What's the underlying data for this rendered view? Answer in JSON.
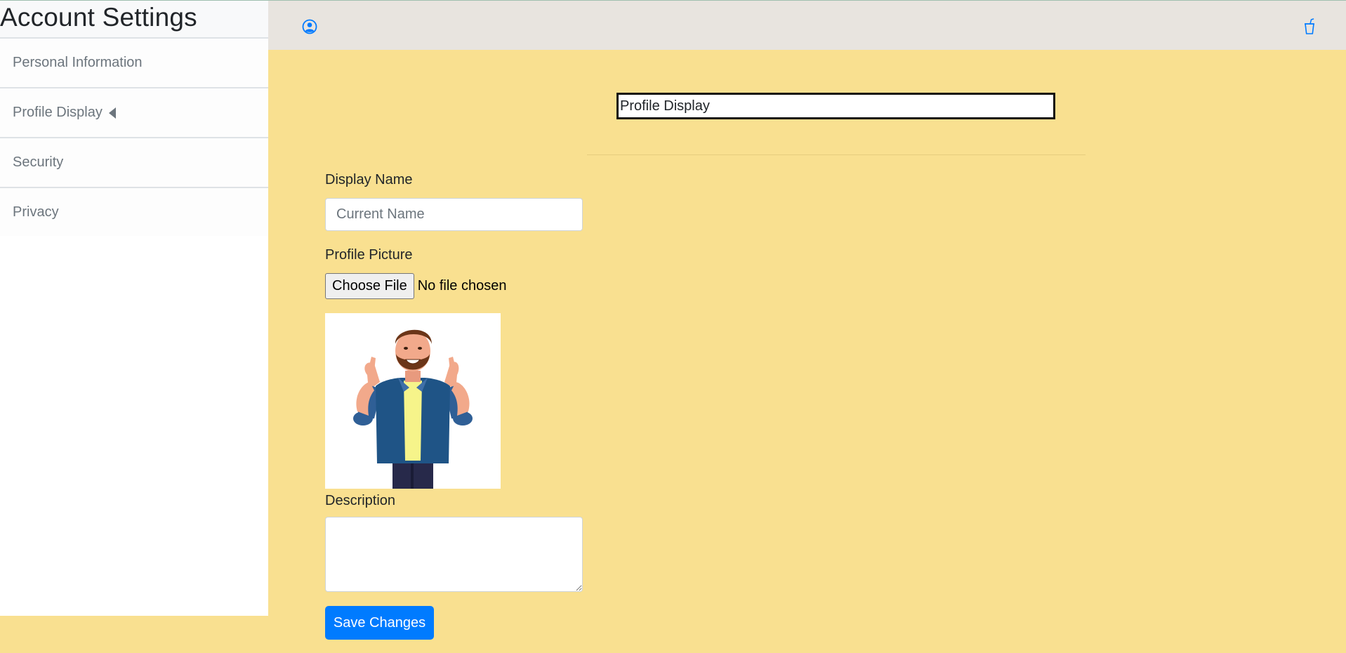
{
  "sidebar": {
    "title": "Account Settings",
    "items": [
      {
        "label": "Personal Information"
      },
      {
        "label": "Profile Display",
        "active": true
      },
      {
        "label": "Security"
      },
      {
        "label": "Privacy"
      }
    ]
  },
  "topbar": {
    "left_icon": "user-circle-icon",
    "right_icon": "cup-icon",
    "icon_color": "#007bff"
  },
  "main": {
    "section_title": "Profile Display",
    "display_name": {
      "label": "Display Name",
      "value": "",
      "placeholder": "Current Name"
    },
    "profile_picture": {
      "label": "Profile Picture",
      "button_label": "Choose File",
      "status": "No file chosen"
    },
    "description": {
      "label": "Description",
      "value": ""
    },
    "save_label": "Save Changes"
  },
  "colors": {
    "background": "#f9e090",
    "topbar": "#e8e4df",
    "primary": "#007bff"
  }
}
